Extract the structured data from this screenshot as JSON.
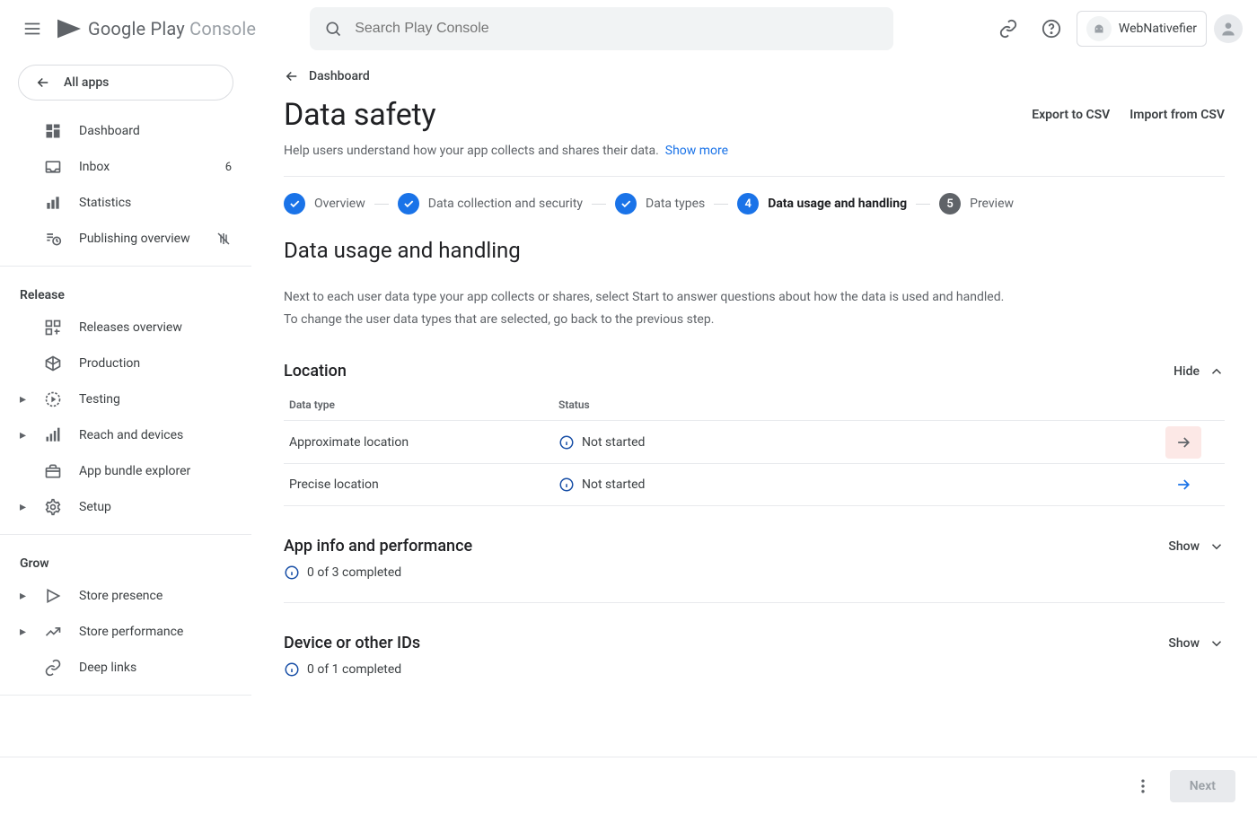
{
  "header": {
    "search_placeholder": "Search Play Console",
    "logo_1": "Google Play",
    "logo_2": "Console",
    "developer_name": "WebNativefier"
  },
  "sidebar": {
    "all_apps": "All apps",
    "top": [
      {
        "label": "Dashboard"
      },
      {
        "label": "Inbox",
        "badge": "6"
      },
      {
        "label": "Statistics"
      },
      {
        "label": "Publishing overview",
        "right_icon": true
      }
    ],
    "release_header": "Release",
    "release": [
      {
        "label": "Releases overview"
      },
      {
        "label": "Production"
      },
      {
        "label": "Testing",
        "expandable": true
      },
      {
        "label": "Reach and devices",
        "expandable": true
      },
      {
        "label": "App bundle explorer"
      },
      {
        "label": "Setup",
        "expandable": true
      }
    ],
    "grow_header": "Grow",
    "grow": [
      {
        "label": "Store presence",
        "expandable": true
      },
      {
        "label": "Store performance",
        "expandable": true
      },
      {
        "label": "Deep links"
      }
    ]
  },
  "main": {
    "crumb": "Dashboard",
    "title": "Data safety",
    "actions": {
      "export": "Export to CSV",
      "import": "Import from CSV"
    },
    "desc": "Help users understand how your app collects and shares their data.",
    "show_more": "Show more",
    "steps": [
      {
        "state": "done",
        "label": "Overview"
      },
      {
        "state": "done",
        "label": "Data collection and security"
      },
      {
        "state": "done",
        "label": "Data types"
      },
      {
        "state": "current",
        "num": "4",
        "label": "Data usage and handling"
      },
      {
        "state": "future",
        "num": "5",
        "label": "Preview"
      }
    ],
    "section_title": "Data usage and handling",
    "section_p1": "Next to each user data type your app collects or shares, select Start to answer questions about how the data is used and handled.",
    "section_p2": "To change the user data types that are selected, go back to the previous step.",
    "table_headers": {
      "type": "Data type",
      "status": "Status"
    },
    "categories": [
      {
        "title": "Location",
        "toggle": "Hide",
        "expanded": true,
        "rows": [
          {
            "type": "Approximate location",
            "status": "Not started",
            "highlight": true
          },
          {
            "type": "Precise location",
            "status": "Not started",
            "highlight": false
          }
        ]
      },
      {
        "title": "App info and performance",
        "toggle": "Show",
        "expanded": false,
        "sub": "0 of 3 completed"
      },
      {
        "title": "Device or other IDs",
        "toggle": "Show",
        "expanded": false,
        "sub": "0 of 1 completed"
      }
    ]
  },
  "footer": {
    "next": "Next"
  }
}
